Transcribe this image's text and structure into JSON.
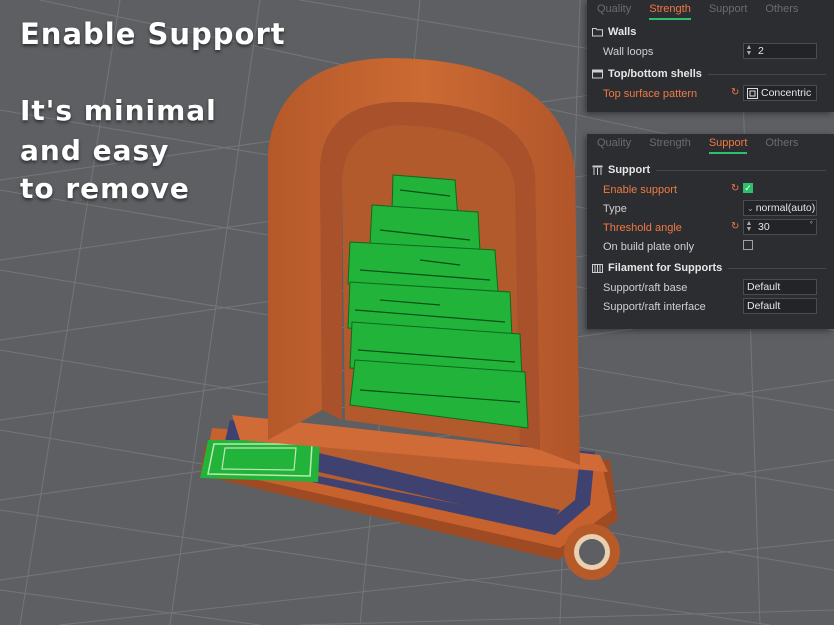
{
  "overlay": {
    "title": "Enable Support",
    "line1": "It's minimal",
    "line2": "and easy",
    "line3": "to remove"
  },
  "panel_top": {
    "tabs": [
      {
        "label": "Quality",
        "active": false
      },
      {
        "label": "Strength",
        "active": true
      },
      {
        "label": "Support",
        "active": false
      },
      {
        "label": "Others",
        "active": false
      }
    ],
    "walls_header": "Walls",
    "wall_loops_label": "Wall loops",
    "wall_loops_value": "2",
    "shells_header": "Top/bottom shells",
    "top_surface_label": "Top surface pattern",
    "top_surface_value": "Concentric"
  },
  "panel_bottom": {
    "tabs": [
      {
        "label": "Quality",
        "active": false
      },
      {
        "label": "Strength",
        "active": false
      },
      {
        "label": "Support",
        "active": true
      },
      {
        "label": "Others",
        "active": false
      }
    ],
    "support_header": "Support",
    "enable_support_label": "Enable support",
    "enable_support_checked": true,
    "type_label": "Type",
    "type_value": "normal(auto)",
    "threshold_label": "Threshold angle",
    "threshold_value": "30",
    "threshold_unit": "°",
    "build_plate_label": "On build plate only",
    "build_plate_checked": false,
    "filament_header": "Filament for Supports",
    "raft_base_label": "Support/raft base",
    "raft_base_value": "Default",
    "raft_interface_label": "Support/raft interface",
    "raft_interface_value": "Default"
  },
  "colors": {
    "background": "#5d5f63",
    "model": "#c2622c",
    "support": "#22b33a",
    "panel": "#2c2d30",
    "accent": "#f07a45",
    "active_tab_underline": "#2dbf6c"
  }
}
